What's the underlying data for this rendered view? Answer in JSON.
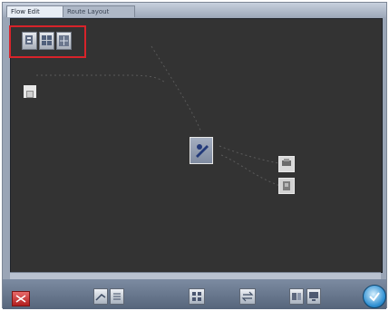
{
  "tabs": [
    {
      "label": "Flow Edit",
      "active": true
    },
    {
      "label": "Route Layout",
      "active": false
    }
  ],
  "toolbar": {
    "buttons": [
      {
        "name": "add-node-button",
        "icon": "add-node-icon"
      },
      {
        "name": "grid-view-button",
        "icon": "grid-icon"
      },
      {
        "name": "layout-button",
        "icon": "layout-icon"
      }
    ],
    "highlight_color": "#d8232a"
  },
  "nodes": [
    {
      "name": "source-node",
      "label": "",
      "icon": "document-icon"
    },
    {
      "name": "processing-node",
      "label": "",
      "icon": "edit-icon"
    },
    {
      "name": "output-node-1",
      "label": "",
      "icon": "printer-icon"
    },
    {
      "name": "output-node-2",
      "label": "",
      "icon": "storage-icon"
    }
  ],
  "bottom_toolbar": [
    {
      "name": "close-button",
      "icon": "close-icon"
    },
    {
      "name": "route-button",
      "icon": "route-icon"
    },
    {
      "name": "list-button",
      "icon": "list-icon"
    },
    {
      "name": "grid-button",
      "icon": "grid-icon"
    },
    {
      "name": "transfer-button",
      "icon": "transfer-icon"
    },
    {
      "name": "compare-button",
      "icon": "compare-icon"
    },
    {
      "name": "monitor-button",
      "icon": "monitor-icon"
    },
    {
      "name": "confirm-button",
      "icon": "confirm-icon"
    }
  ]
}
